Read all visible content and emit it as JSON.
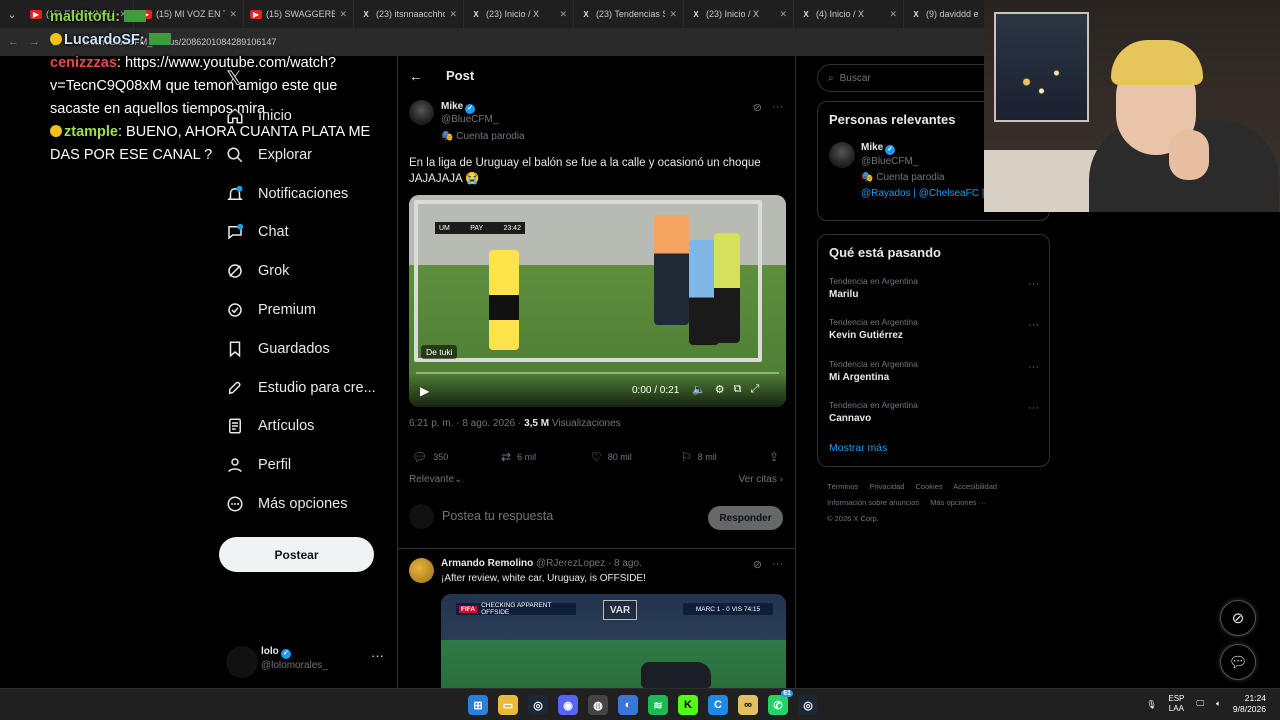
{
  "browser": {
    "tabs": [
      {
        "title": "(15) EENDYNAU...",
        "kind": "yt"
      },
      {
        "title": "(15) MI VOZ EN TU",
        "kind": "yt"
      },
      {
        "title": "(15) SWAGGERBO",
        "kind": "yt"
      },
      {
        "title": "(23) itsnnaacchho",
        "kind": "x"
      },
      {
        "title": "(23) Inicio / X",
        "kind": "x"
      },
      {
        "title": "(23) Tendencias S",
        "kind": "x"
      },
      {
        "title": "(23) Inicio / X",
        "kind": "x"
      },
      {
        "title": "(4) Inicio / X",
        "kind": "x"
      },
      {
        "title": "(9) daviddd e",
        "kind": "x"
      }
    ],
    "url": "x.com/BlueCFM_/status/2086201084289106147"
  },
  "chat": {
    "msg1_user": "malditofu:",
    "msg2_user": "LucardoSF:",
    "msg3_user": "cenizzzas",
    "msg3_text": ": https://www.youtube.com/watch?v=TecnC9Q08xM que temon amigo este que sacaste en aquellos tiempos mira",
    "msg4_user": "ztample",
    "msg4_text": ": BUENO, AHORA CUANTA PLATA ME DAS POR ESE CANAL ?"
  },
  "nav": {
    "items": [
      {
        "label": "Inicio",
        "icon": "home-icon"
      },
      {
        "label": "Explorar",
        "icon": "search-icon"
      },
      {
        "label": "Notificaciones",
        "icon": "bell-icon"
      },
      {
        "label": "Chat",
        "icon": "chat-icon"
      },
      {
        "label": "Grok",
        "icon": "grok-icon"
      },
      {
        "label": "Premium",
        "icon": "premium-icon"
      },
      {
        "label": "Guardados",
        "icon": "bookmark-icon"
      },
      {
        "label": "Estudio para cre...",
        "icon": "rocket-icon"
      },
      {
        "label": "Artículos",
        "icon": "article-icon"
      },
      {
        "label": "Perfil",
        "icon": "person-icon"
      },
      {
        "label": "Más opciones",
        "icon": "more-circle-icon"
      }
    ],
    "post_button": "Postear",
    "account": {
      "name": "lolo",
      "handle": "@lolomorales_"
    }
  },
  "post": {
    "header_title": "Post",
    "author_name": "Mike",
    "author_handle": "@BlueCFM_",
    "author_label": "Cuenta parodia",
    "text": "En la liga de Uruguay el balón se fue a la calle y ocasionó un choque JAJAJAJA 😭",
    "video": {
      "scoreboard_left": "UM",
      "scoreboard_right": "PAY",
      "scoreboard_time": "23:42",
      "source_tag": "De tuki",
      "time": "0:00 / 0:21",
      "progress": 0.0
    },
    "time": "6:21 p. m. · 8 ago. 2026",
    "views_count": "3,5 M",
    "views_label": "Visualizaciones",
    "replies": "350",
    "reposts": "6 mil",
    "likes": "80 mil",
    "bookmarks": "8 mil",
    "sort_label": "Relevante",
    "quotes_label": "Ver citas",
    "reply_placeholder": "Postea tu respuesta",
    "reply_button": "Responder"
  },
  "reply": {
    "name": "Armando Remolino",
    "meta": "@RJerezLopez · 8 ago.",
    "text": "¡After review,   white car, Uruguay, is OFFSIDE!",
    "media_header": "CHECKING APPARENT OFFSIDE",
    "media_fifa": "FIFA",
    "media_var": "VAR",
    "media_score": "MARC 1 - 0 VIS 74:15"
  },
  "sidebar": {
    "search_placeholder": "Buscar",
    "relevant_title": "Personas relevantes",
    "relevant": {
      "name": "Mike",
      "handle": "@BlueCFM_",
      "label": "Cuenta parodia",
      "bio": "@Rayados | @ChelseaFC | F"
    },
    "trends_title": "Qué está pasando",
    "trends": [
      {
        "category": "Tendencia en Argentina",
        "name": "Marilu"
      },
      {
        "category": "Tendencia en Argentina",
        "name": "Kevin Gutiérrez"
      },
      {
        "category": "Tendencia en Argentina",
        "name": "Mi Argentina"
      },
      {
        "category": "Tendencia en Argentina",
        "name": "Cannavo"
      }
    ],
    "show_more": "Mostrar más",
    "footer": [
      "Términos",
      "Privacidad",
      "Cookies",
      "Accesibilidad",
      "Información sobre anuncios",
      "Más opciones ···",
      "© 2026 X Corp."
    ]
  },
  "taskbar": {
    "lang_top": "ESP",
    "lang_bottom": "LAA",
    "time": "21:24",
    "date": "9/8/2026",
    "badge": "61"
  },
  "colors": {
    "accent": "#1d9bf0",
    "bg": "#000000",
    "muted": "#71767b"
  }
}
